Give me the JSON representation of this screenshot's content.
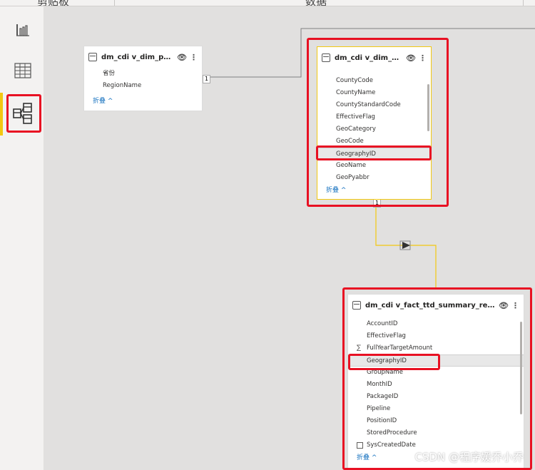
{
  "ribbon": {
    "group1": "剪贴板",
    "group2": "数据"
  },
  "nav": {
    "items": [
      "report-view",
      "data-view",
      "model-view"
    ],
    "active": "model-view"
  },
  "tables": {
    "position": {
      "title": "dm_cdi v_dim_positio...",
      "fields": [
        "省份",
        "RegionName"
      ],
      "collapse": "折叠 ^"
    },
    "geography": {
      "title": "dm_cdi v_dim_geogra...",
      "fields": [
        "CountyCode",
        "CountyName",
        "CountyStandardCode",
        "EffectiveFlag",
        "GeoCategory",
        "GeoCode",
        "GeographyID",
        "GeoName",
        "GeoPyabbr"
      ],
      "collapse": "折叠 ^"
    },
    "summary": {
      "title": "dm_cdi v_fact_ttd_summary_report",
      "fields": [
        "AccountID",
        "EffectiveFlag",
        "FullYearTargetAmount",
        "GeographyID",
        "GroupName",
        "MonthID",
        "PackageID",
        "Pipeline",
        "PositionID",
        "StoredProcedure",
        "SysCreatedDate"
      ],
      "collapse": "折叠 ^"
    }
  },
  "relations": {
    "pos_geo_label": "1",
    "geo_label": "1"
  },
  "colors": {
    "highlight": "#e81123",
    "relation": "#f2c811",
    "accent": "#106ebe"
  },
  "watermark": "CSDN @程序媛乔小乔"
}
